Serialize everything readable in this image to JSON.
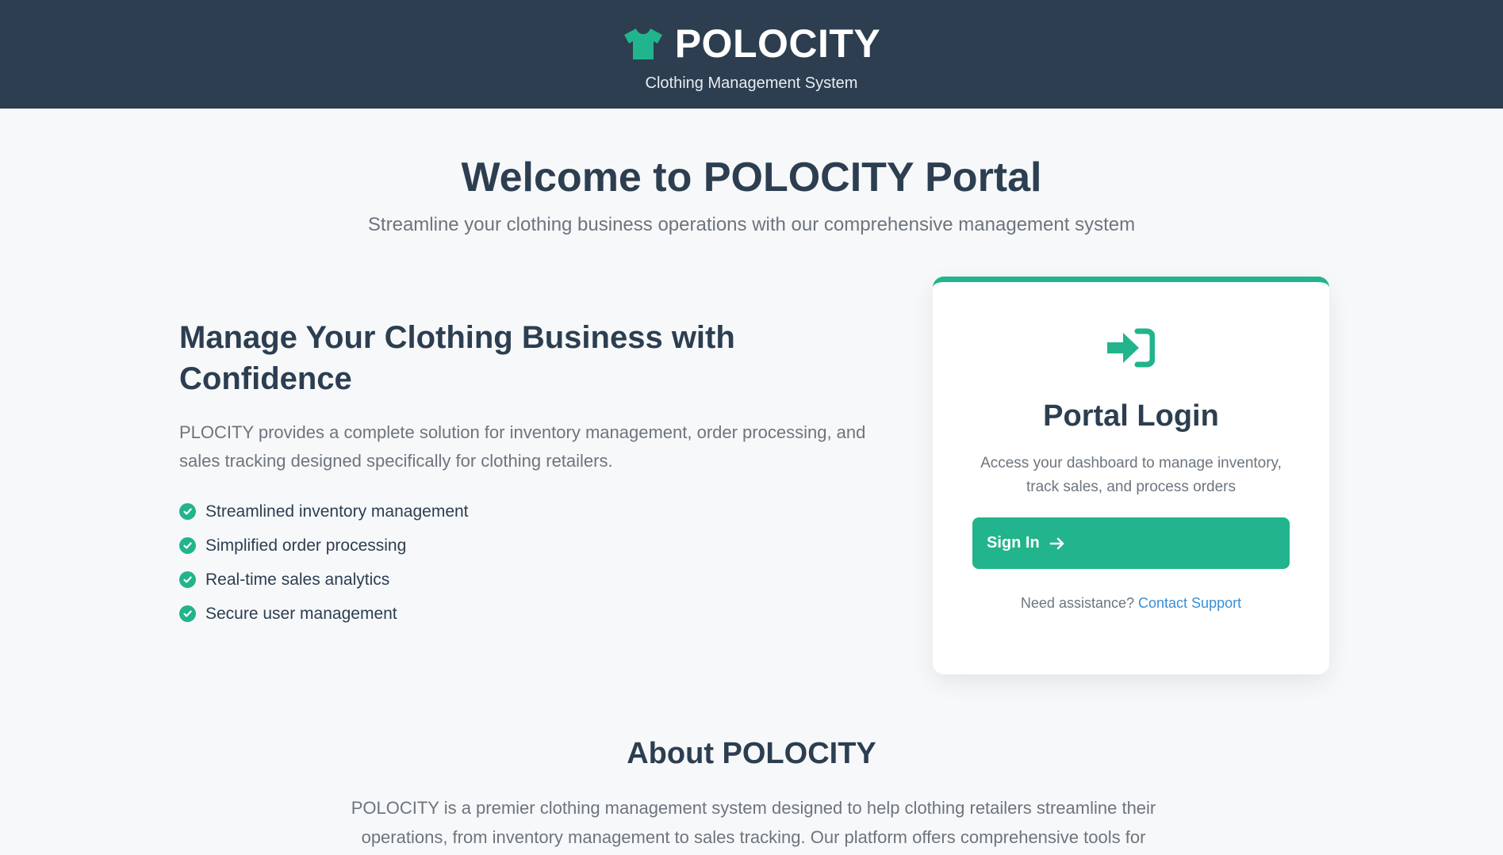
{
  "colors": {
    "header_bg": "#2c3e50",
    "accent": "#22b48c",
    "link": "#3b8ed4",
    "page_bg": "#f7f8fa"
  },
  "header": {
    "logo_icon": "tshirt-icon",
    "brand": "POLOCITY",
    "subtitle": "Clothing Management System"
  },
  "welcome": {
    "title": "Welcome to POLOCITY Portal",
    "subtitle": "Streamline your clothing business operations with our comprehensive management system"
  },
  "intro": {
    "heading": "Manage Your Clothing Business with Confidence",
    "description": "PLOCITY provides a complete solution for inventory management, order processing, and sales tracking designed specifically for clothing retailers.",
    "features": [
      "Streamlined inventory management",
      "Simplified order processing",
      "Real-time sales analytics",
      "Secure user management"
    ]
  },
  "login": {
    "icon": "sign-in-icon",
    "title": "Portal Login",
    "description": "Access your dashboard to manage inventory, track sales, and process orders",
    "button_label": "Sign In",
    "assist_text": "Need assistance?",
    "support_link": "Contact Support"
  },
  "about": {
    "title": "About POLOCITY",
    "text": "POLOCITY is a premier clothing management system designed to help clothing retailers streamline their operations, from inventory management to sales tracking. Our platform offers comprehensive tools for"
  }
}
